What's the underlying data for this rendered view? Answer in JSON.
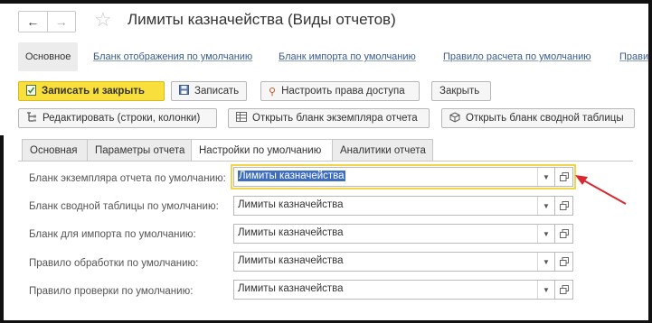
{
  "window": {
    "title": "Лимиты казначейства (Виды отчетов)"
  },
  "topnav": {
    "items": [
      "Основное",
      "Бланк отображения по умолчанию",
      "Бланк импорта по умолчанию",
      "Правило расчета по умолчанию",
      "Прави"
    ]
  },
  "toolbar": {
    "save_close": "Записать и закрыть",
    "save": "Записать",
    "access": "Настроить права доступа",
    "close": "Закрыть"
  },
  "toolbar2": {
    "edit": "Редактировать (строки, колонки)",
    "open_instance": "Открыть бланк экземпляра отчета",
    "open_pivot": "Открыть бланк сводной таблицы"
  },
  "tabs": [
    "Основная",
    "Параметры отчета",
    "Настройки по умолчанию",
    "Аналитики отчета"
  ],
  "form": {
    "rows": [
      {
        "label": "Бланк экземпляра отчета по умолчанию:",
        "value": "Лимиты казначейства"
      },
      {
        "label": "Бланк сводной таблицы по умолчанию:",
        "value": "Лимиты казначейства"
      },
      {
        "label": "Бланк для импорта по умолчанию:",
        "value": "Лимиты казначейства"
      },
      {
        "label": "Правило обработки по умолчанию:",
        "value": "Лимиты казначейства"
      },
      {
        "label": "Правило проверки по умолчанию:",
        "value": "Лимиты казначейства"
      }
    ]
  },
  "colors": {
    "accent_yellow": "#f9df3c",
    "link_blue": "#3b5a8c",
    "selection_blue": "#3e6fbf",
    "arrow_red": "#d9282f"
  }
}
